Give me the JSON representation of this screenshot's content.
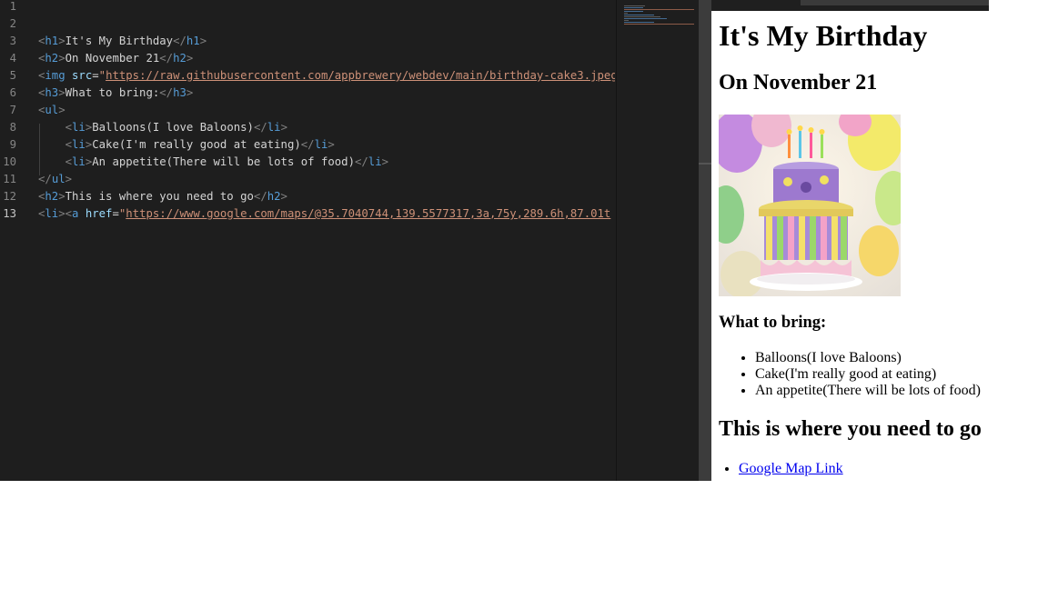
{
  "editor": {
    "line_numbers": [
      "1",
      "2",
      "3",
      "4",
      "5",
      "6",
      "7",
      "8",
      "9",
      "10",
      "11",
      "12",
      "13"
    ],
    "active_line": "13",
    "lines": [
      {
        "tokens": []
      },
      {
        "tokens": []
      },
      {
        "tokens": [
          [
            "b",
            "<"
          ],
          [
            "t",
            "h1"
          ],
          [
            "b",
            ">"
          ],
          [
            "x",
            "It's My Birthday"
          ],
          [
            "b",
            "</"
          ],
          [
            "t",
            "h1"
          ],
          [
            "b",
            ">"
          ]
        ]
      },
      {
        "tokens": [
          [
            "b",
            "<"
          ],
          [
            "t",
            "h2"
          ],
          [
            "b",
            ">"
          ],
          [
            "x",
            "On November 21"
          ],
          [
            "b",
            "</"
          ],
          [
            "t",
            "h2"
          ],
          [
            "b",
            ">"
          ]
        ]
      },
      {
        "tokens": [
          [
            "b",
            "<"
          ],
          [
            "t",
            "img"
          ],
          [
            "x",
            " "
          ],
          [
            "a",
            "src"
          ],
          [
            "e",
            "="
          ],
          [
            "s",
            "\""
          ],
          [
            "u",
            "https://raw.githubusercontent.com/appbrewery/webdev/main/birthday-cake3.jpeg"
          ]
        ]
      },
      {
        "tokens": [
          [
            "b",
            "<"
          ],
          [
            "t",
            "h3"
          ],
          [
            "b",
            ">"
          ],
          [
            "x",
            "What to bring:"
          ],
          [
            "b",
            "</"
          ],
          [
            "t",
            "h3"
          ],
          [
            "b",
            ">"
          ]
        ]
      },
      {
        "tokens": [
          [
            "b",
            "<"
          ],
          [
            "t",
            "ul"
          ],
          [
            "b",
            ">"
          ]
        ]
      },
      {
        "tokens": [
          [
            "x",
            "    "
          ],
          [
            "b",
            "<"
          ],
          [
            "t",
            "li"
          ],
          [
            "b",
            ">"
          ],
          [
            "x",
            "Balloons(I love Baloons)"
          ],
          [
            "b",
            "</"
          ],
          [
            "t",
            "li"
          ],
          [
            "b",
            ">"
          ]
        ]
      },
      {
        "tokens": [
          [
            "x",
            "    "
          ],
          [
            "b",
            "<"
          ],
          [
            "t",
            "li"
          ],
          [
            "b",
            ">"
          ],
          [
            "x",
            "Cake(I'm really good at eating)"
          ],
          [
            "b",
            "</"
          ],
          [
            "t",
            "li"
          ],
          [
            "b",
            ">"
          ]
        ]
      },
      {
        "tokens": [
          [
            "x",
            "    "
          ],
          [
            "b",
            "<"
          ],
          [
            "t",
            "li"
          ],
          [
            "b",
            ">"
          ],
          [
            "x",
            "An appetite(There will be lots of food)"
          ],
          [
            "b",
            "</"
          ],
          [
            "t",
            "li"
          ],
          [
            "b",
            ">"
          ]
        ]
      },
      {
        "tokens": [
          [
            "b",
            "</"
          ],
          [
            "t",
            "ul"
          ],
          [
            "b",
            ">"
          ]
        ]
      },
      {
        "tokens": [
          [
            "b",
            "<"
          ],
          [
            "t",
            "h2"
          ],
          [
            "b",
            ">"
          ],
          [
            "x",
            "This is where you need to go"
          ],
          [
            "b",
            "</"
          ],
          [
            "t",
            "h2"
          ],
          [
            "b",
            ">"
          ]
        ]
      },
      {
        "tokens": [
          [
            "b",
            "<"
          ],
          [
            "t",
            "li"
          ],
          [
            "b",
            "><"
          ],
          [
            "t",
            "a"
          ],
          [
            "x",
            " "
          ],
          [
            "a",
            "href"
          ],
          [
            "e",
            "="
          ],
          [
            "s",
            "\""
          ],
          [
            "u",
            "https://www.google.com/maps/@35.7040744,139.5577317,3a,75y,289.6h,87.01t"
          ]
        ]
      }
    ]
  },
  "preview": {
    "h1": "It's My Birthday",
    "h2_date": "On November 21",
    "image_alt": "birthday cake",
    "h3": "What to bring:",
    "items": [
      "Balloons(I love Baloons)",
      "Cake(I'm really good at eating)",
      "An appetite(There will be lots of food)"
    ],
    "h2_where": "This is where you need to go",
    "link_text": "Google Map Link"
  },
  "colors": {
    "editor_bg": "#1e1e1e",
    "tag": "#569cd6",
    "attr": "#9cdcfe",
    "string": "#ce9178",
    "bracket": "#808080",
    "text": "#d4d4d4",
    "link": "#0000ee"
  }
}
